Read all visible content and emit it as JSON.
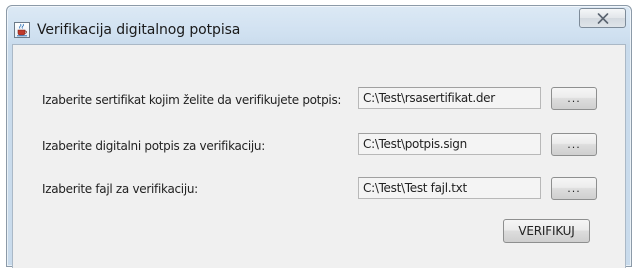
{
  "window": {
    "title": "Verifikacija digitalnog potpisa",
    "icon": "java-cup-icon",
    "close_icon": "close-icon"
  },
  "form": {
    "rows": [
      {
        "label": "Izaberite sertifikat kojim želite da verifikujete potpis:",
        "value": "C:\\Test\\rsasertifikat.der",
        "browse_label": "..."
      },
      {
        "label": "Izaberite digitalni potpis za verifikaciju:",
        "value": "C:\\Test\\potpis.sign",
        "browse_label": "..."
      },
      {
        "label": "Izaberite fajl za verifikaciju:",
        "value": "C:\\Test\\Test fajl.txt",
        "browse_label": "..."
      }
    ],
    "verify_label": "VERIFIKUJ"
  }
}
